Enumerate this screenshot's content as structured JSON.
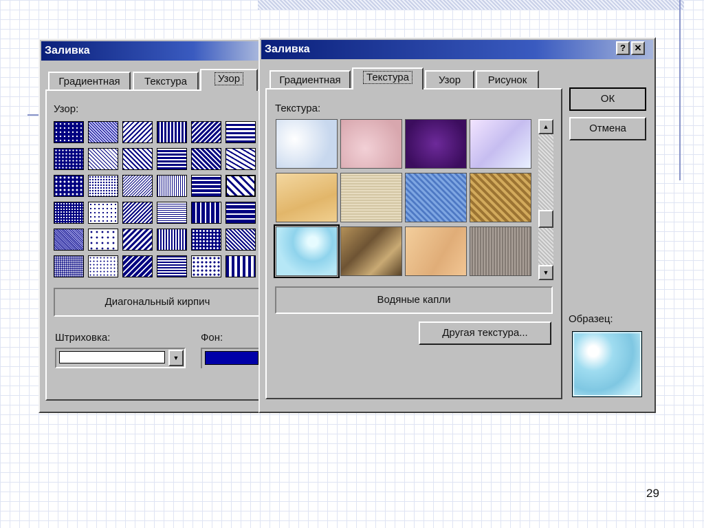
{
  "slide": {
    "number": "29"
  },
  "back_dialog": {
    "title": "Заливка",
    "tabs": [
      "Градиентная",
      "Текстура",
      "Узор"
    ],
    "pattern_label": "Узор:",
    "pattern_name": "Диагональный кирпич",
    "hatch_label": "Штриховка:",
    "bg_label": "Фон:",
    "colors": {
      "foreground": "#000080",
      "background": "#ffffff",
      "bg_swatch": "#0000a8"
    }
  },
  "front_dialog": {
    "title": "Заливка",
    "help_button": "?",
    "close_button": "✕",
    "tabs": [
      "Градиентная",
      "Текстура",
      "Узор",
      "Рисунок"
    ],
    "texture_label": "Текстура:",
    "texture_name": "Водяные капли",
    "other_texture_button": "Другая текстура...",
    "ok_button": "ОК",
    "cancel_button": "Отмена",
    "sample_label": "Образец:",
    "scroll_up": "▲",
    "scroll_down": "▼"
  }
}
